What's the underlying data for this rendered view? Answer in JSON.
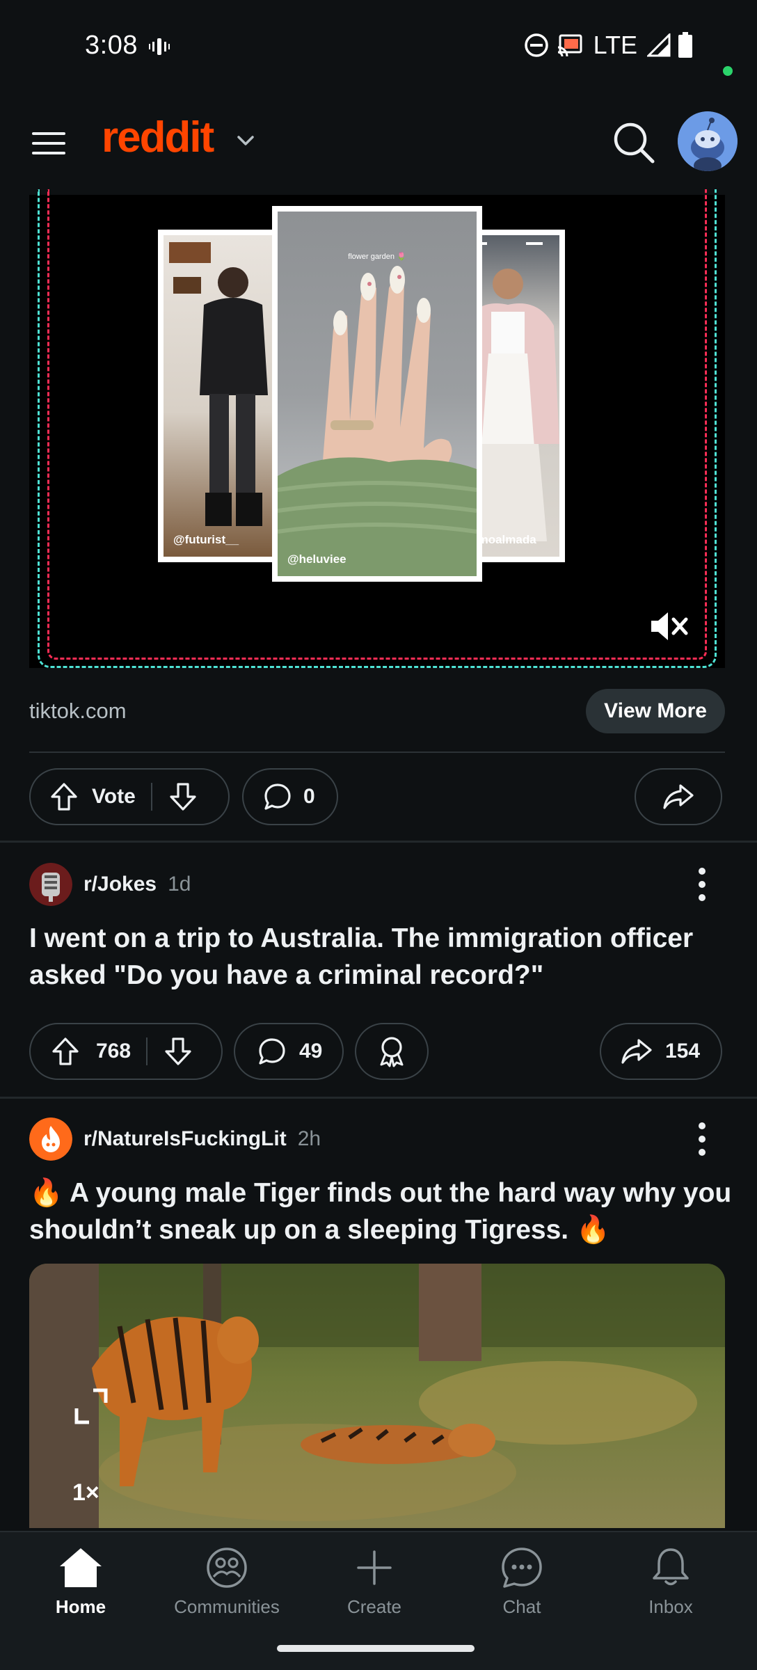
{
  "status_bar": {
    "time": "3:08",
    "network": "LTE"
  },
  "header": {
    "logo": "reddit",
    "accent_color": "#ff4500"
  },
  "ad": {
    "cards": [
      {
        "handle": "@futurist__"
      },
      {
        "handle": "@heluviee",
        "caption": "flower garden 🌷"
      },
      {
        "handle": "@moalmada"
      }
    ],
    "domain": "tiktok.com",
    "cta": "View More",
    "vote_label": "Vote",
    "comments": "0"
  },
  "posts": [
    {
      "subreddit": "r/Jokes",
      "age": "1d",
      "title": "I went on a trip to Australia. The immigration officer asked \"Do you have a criminal record?\"",
      "upvotes": "768",
      "comments": "49",
      "shares": "154"
    },
    {
      "subreddit": "r/NatureIsFuckingLit",
      "age": "2h",
      "title": "🔥 A young male Tiger finds out the hard way why you shouldn’t sneak up on a sleeping Tigress. 🔥",
      "playback_speed": "1×"
    }
  ],
  "bottom_nav": [
    {
      "label": "Home",
      "icon": "home-icon",
      "active": true
    },
    {
      "label": "Communities",
      "icon": "communities-icon"
    },
    {
      "label": "Create",
      "icon": "plus-icon"
    },
    {
      "label": "Chat",
      "icon": "chat-icon"
    },
    {
      "label": "Inbox",
      "icon": "bell-icon"
    }
  ]
}
